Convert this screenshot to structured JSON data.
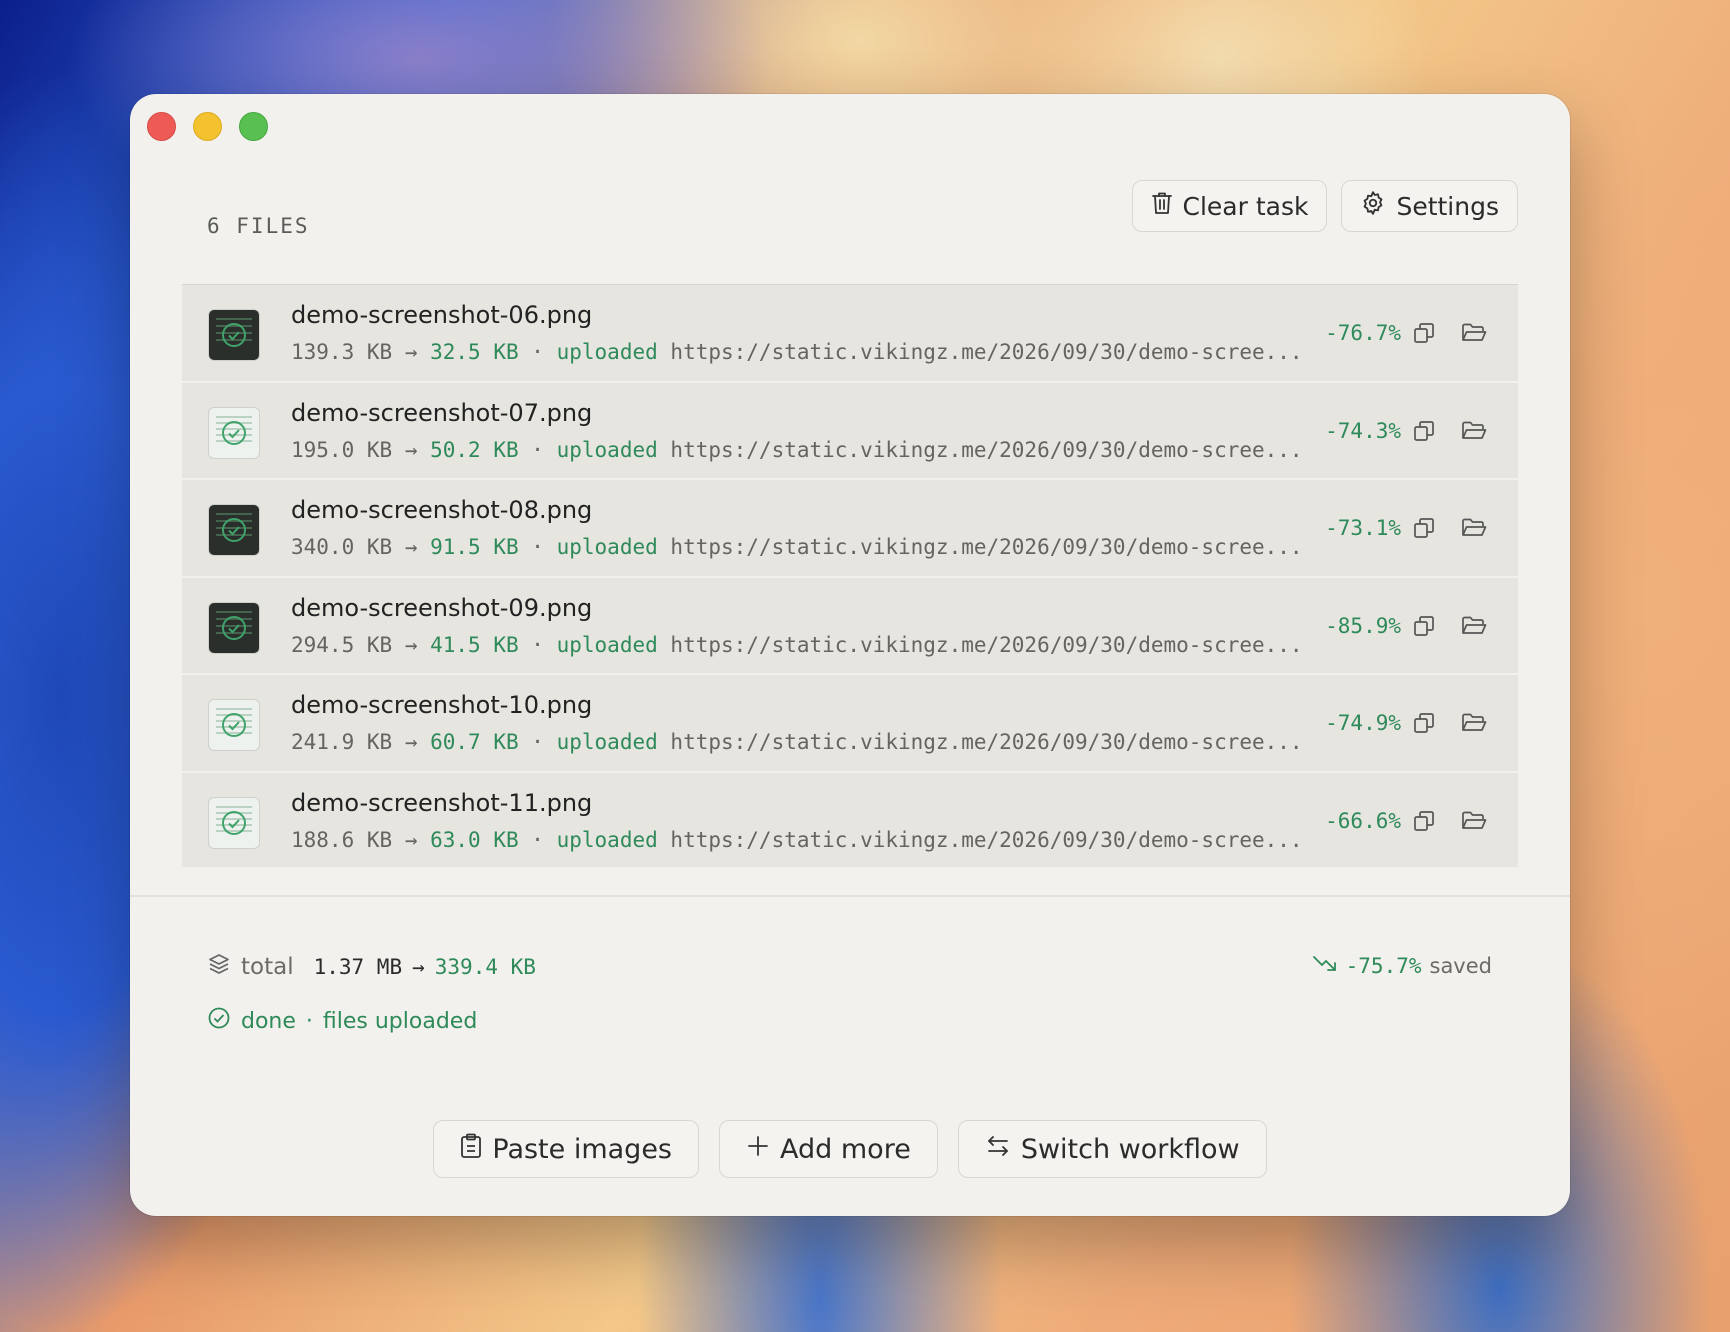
{
  "window": {
    "controls": [
      "close",
      "minimize",
      "zoom"
    ]
  },
  "header": {
    "files_count": "6 FILES",
    "clear_task_label": "Clear task",
    "settings_label": "Settings"
  },
  "files": [
    {
      "name": "demo-screenshot-06.png",
      "original": "139.3 KB",
      "arrow": "→",
      "compressed": "32.5 KB",
      "sep": "·",
      "status": "uploaded",
      "url": "https://static.vikingz.me/2026/09/30/demo-scree...",
      "reduction": "-76.7%",
      "thumb": "dark"
    },
    {
      "name": "demo-screenshot-07.png",
      "original": "195.0 KB",
      "arrow": "→",
      "compressed": "50.2 KB",
      "sep": "·",
      "status": "uploaded",
      "url": "https://static.vikingz.me/2026/09/30/demo-scree...",
      "reduction": "-74.3%",
      "thumb": "light"
    },
    {
      "name": "demo-screenshot-08.png",
      "original": "340.0 KB",
      "arrow": "→",
      "compressed": "91.5 KB",
      "sep": "·",
      "status": "uploaded",
      "url": "https://static.vikingz.me/2026/09/30/demo-scree...",
      "reduction": "-73.1%",
      "thumb": "dark"
    },
    {
      "name": "demo-screenshot-09.png",
      "original": "294.5 KB",
      "arrow": "→",
      "compressed": "41.5 KB",
      "sep": "·",
      "status": "uploaded",
      "url": "https://static.vikingz.me/2026/09/30/demo-scree...",
      "reduction": "-85.9%",
      "thumb": "dark"
    },
    {
      "name": "demo-screenshot-10.png",
      "original": "241.9 KB",
      "arrow": "→",
      "compressed": "60.7 KB",
      "sep": "·",
      "status": "uploaded",
      "url": "https://static.vikingz.me/2026/09/30/demo-scree...",
      "reduction": "-74.9%",
      "thumb": "light"
    },
    {
      "name": "demo-screenshot-11.png",
      "original": "188.6 KB",
      "arrow": "→",
      "compressed": "63.0 KB",
      "sep": "·",
      "status": "uploaded",
      "url": "https://static.vikingz.me/2026/09/30/demo-scree...",
      "reduction": "-66.6%",
      "thumb": "light"
    }
  ],
  "summary": {
    "total_label": "total",
    "total_original": "1.37 MB",
    "arrow": "→",
    "total_compressed": "339.4 KB",
    "saved_pct": "-75.7%",
    "saved_word": "saved",
    "status_done": "done",
    "status_sep": "·",
    "status_text": "files uploaded"
  },
  "footer": {
    "paste_label": "Paste images",
    "add_label": "Add more",
    "switch_label": "Switch workflow"
  },
  "colors": {
    "accent_green": "#2f8a5a",
    "window_bg": "#f2f1ed",
    "list_bg": "#e6e5e0"
  },
  "icons": [
    "trash-icon",
    "gear-icon",
    "copy-icon",
    "folder-open-icon",
    "layers-icon",
    "trending-down-icon",
    "check-circle-icon",
    "clipboard-icon",
    "plus-icon",
    "swap-icon"
  ]
}
